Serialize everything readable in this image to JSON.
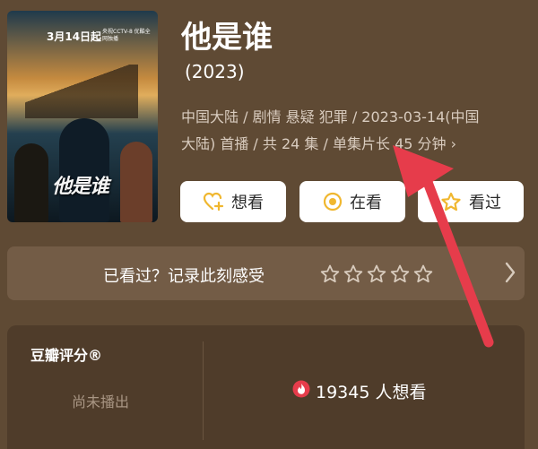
{
  "poster": {
    "title_art": "他是谁",
    "date": "3月14日起",
    "sub": "央视CCTV-8 优酷全网独播"
  },
  "movie": {
    "title": "他是谁",
    "year": "(2023)",
    "meta_line1": "中国大陆 / 剧情 悬疑 犯罪 / 2023-03-14(中国",
    "meta_line2": "大陆) 首播 / 共 24 集 / 单集片长 45 分钟 ›"
  },
  "actions": {
    "want_label": "想看",
    "watching_label": "在看",
    "watched_label": "看过"
  },
  "record": {
    "prompt": "已看过？记录此刻感受",
    "star_count": 5
  },
  "score": {
    "title": "豆瓣评分®",
    "status": "尚未播出",
    "want_count": "19345 人想看"
  },
  "colors": {
    "background": "#5f4a34",
    "accent": "#f0b72f",
    "highlight_red": "#e63c4b"
  }
}
